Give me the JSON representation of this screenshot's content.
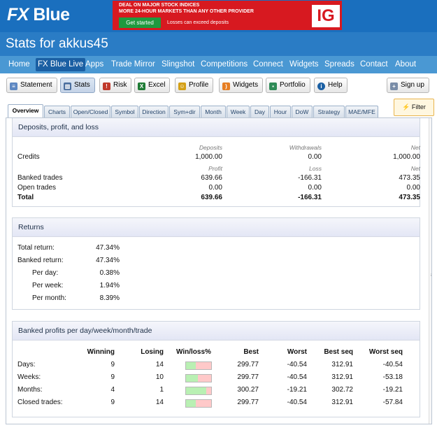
{
  "brand": {
    "logo_fx": "FX",
    "logo_blue": "Blue"
  },
  "ad": {
    "line1": "DEAL ON MAJOR STOCK INDICES",
    "line2": "MORE 24-HOUR MARKETS THAN ANY OTHER PROVIDER",
    "button": "Get started",
    "disclaimer": "Losses can exceed deposits",
    "logo": "IG",
    "color": "#d71920"
  },
  "page": {
    "title": "Stats for akkus45"
  },
  "nav": {
    "items": [
      "Home",
      "FX Blue Live",
      "Apps",
      "Trade Mirror",
      "Slingshot",
      "Competitions",
      "Connect",
      "Widgets",
      "Spreads",
      "Contact",
      "About"
    ],
    "active": "FX Blue Live"
  },
  "toolbar": {
    "statement": "Statement",
    "stats": "Stats",
    "risk": "Risk",
    "excel": "Excel",
    "profile": "Profile",
    "widgets": "Widgets",
    "portfolio": "Portfolio",
    "help": "Help",
    "signup": "Sign up"
  },
  "tabs": [
    "Overview",
    "Charts",
    "Open/Closed",
    "Symbol",
    "Direction",
    "Sym+dir",
    "Month",
    "Week",
    "Day",
    "Hour",
    "DoW",
    "Strategy",
    "MAE/MFE"
  ],
  "filter_label": "Filter",
  "deposits": {
    "title": "Deposits, profit, and loss",
    "head1": [
      "Deposits",
      "Withdrawals",
      "Net"
    ],
    "credits": {
      "label": "Credits",
      "values": [
        "1,000.00",
        "0.00",
        "1,000.00"
      ]
    },
    "head2": [
      "Profit",
      "Loss",
      "Net"
    ],
    "rows": [
      {
        "label": "Banked trades",
        "values": [
          "639.66",
          "-166.31",
          "473.35"
        ]
      },
      {
        "label": "Open trades",
        "values": [
          "0.00",
          "0.00",
          "0.00"
        ]
      }
    ],
    "total": {
      "label": "Total",
      "values": [
        "639.66",
        "-166.31",
        "473.35"
      ]
    }
  },
  "returns": {
    "title": "Returns",
    "rows": [
      {
        "label": "Total return:",
        "value": "47.34%"
      },
      {
        "label": "Banked return:",
        "value": "47.34%"
      },
      {
        "label": "Per day:",
        "value": "0.38%"
      },
      {
        "label": "Per week:",
        "value": "1.94%"
      },
      {
        "label": "Per month:",
        "value": "8.39%"
      }
    ]
  },
  "banked": {
    "title": "Banked profits per day/week/month/trade",
    "headers": [
      "Winning",
      "Losing",
      "Win/loss%",
      "Best",
      "Worst",
      "Best seq",
      "Worst seq"
    ],
    "rows": [
      {
        "label": "Days:",
        "winning": "9",
        "losing": "14",
        "win_fraction": 0.39,
        "best": "299.77",
        "worst": "-40.54",
        "best_seq": "312.91",
        "worst_seq": "-40.54"
      },
      {
        "label": "Weeks:",
        "winning": "9",
        "losing": "10",
        "win_fraction": 0.47,
        "best": "299.77",
        "worst": "-40.54",
        "best_seq": "312.91",
        "worst_seq": "-53.18"
      },
      {
        "label": "Months:",
        "winning": "4",
        "losing": "1",
        "win_fraction": 0.8,
        "best": "300.27",
        "worst": "-19.21",
        "best_seq": "302.72",
        "worst_seq": "-19.21"
      },
      {
        "label": "Closed trades:",
        "winning": "9",
        "losing": "14",
        "win_fraction": 0.39,
        "best": "299.77",
        "worst": "-40.54",
        "best_seq": "312.91",
        "worst_seq": "-57.84"
      }
    ]
  }
}
